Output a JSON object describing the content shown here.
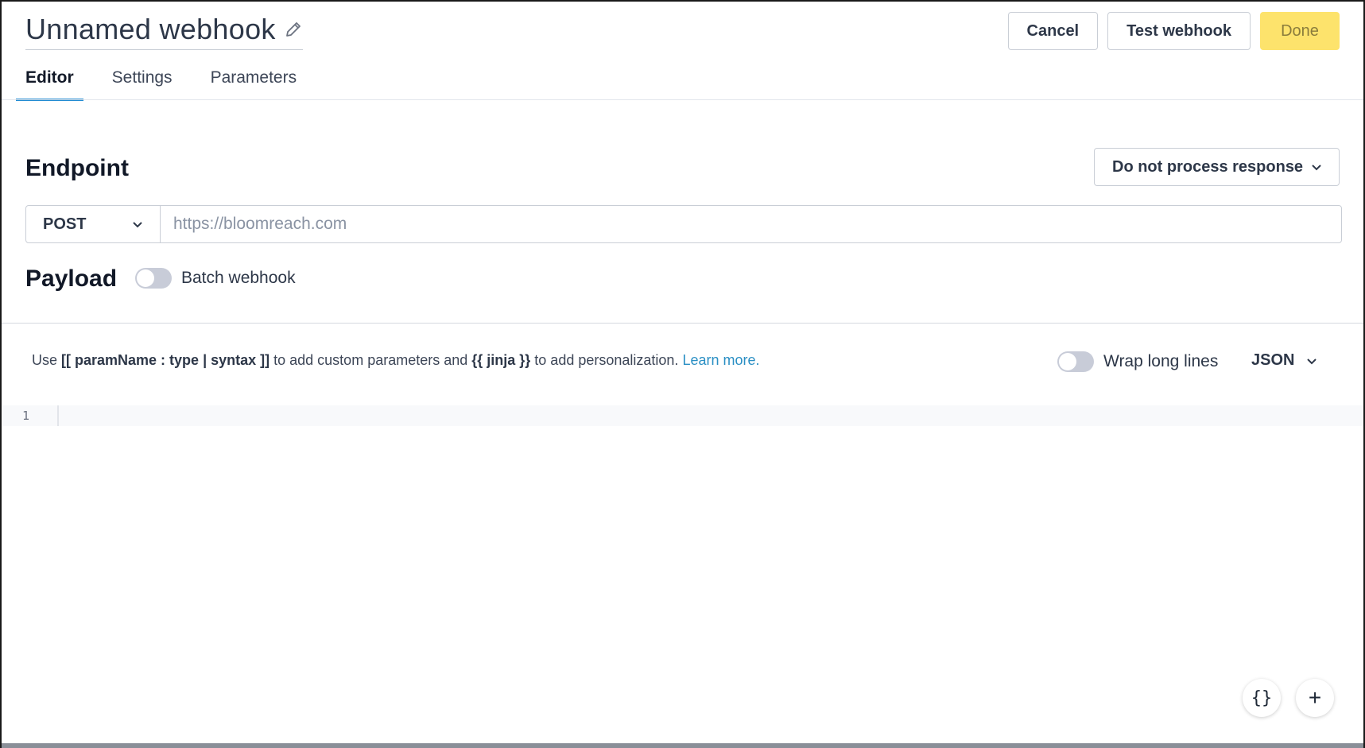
{
  "header": {
    "title": "Unnamed webhook",
    "cancel_label": "Cancel",
    "test_label": "Test webhook",
    "done_label": "Done"
  },
  "tabs": [
    {
      "label": "Editor",
      "active": true
    },
    {
      "label": "Settings",
      "active": false
    },
    {
      "label": "Parameters",
      "active": false
    }
  ],
  "endpoint": {
    "heading": "Endpoint",
    "response_mode": "Do not process response",
    "method": "POST",
    "url_value": "",
    "url_placeholder": "https://bloomreach.com"
  },
  "payload": {
    "heading": "Payload",
    "batch_label": "Batch webhook",
    "batch_enabled": false
  },
  "editor_toolbar": {
    "hint_prefix": "Use ",
    "hint_param_syntax": "[[ paramName : type | syntax ]]",
    "hint_middle": " to add custom parameters and ",
    "hint_jinja": "{{ jinja }}",
    "hint_suffix": " to add personalization. ",
    "learn_more": "Learn more.",
    "wrap_label": "Wrap long lines",
    "wrap_enabled": false,
    "language": "JSON"
  },
  "editor": {
    "line_numbers": [
      "1"
    ]
  },
  "fabs": {
    "braces_icon": "{}",
    "plus_icon": "+"
  },
  "colors": {
    "accent": "#1f8ad2",
    "done_bg": "#fde36c",
    "link": "#2a8fc4"
  }
}
